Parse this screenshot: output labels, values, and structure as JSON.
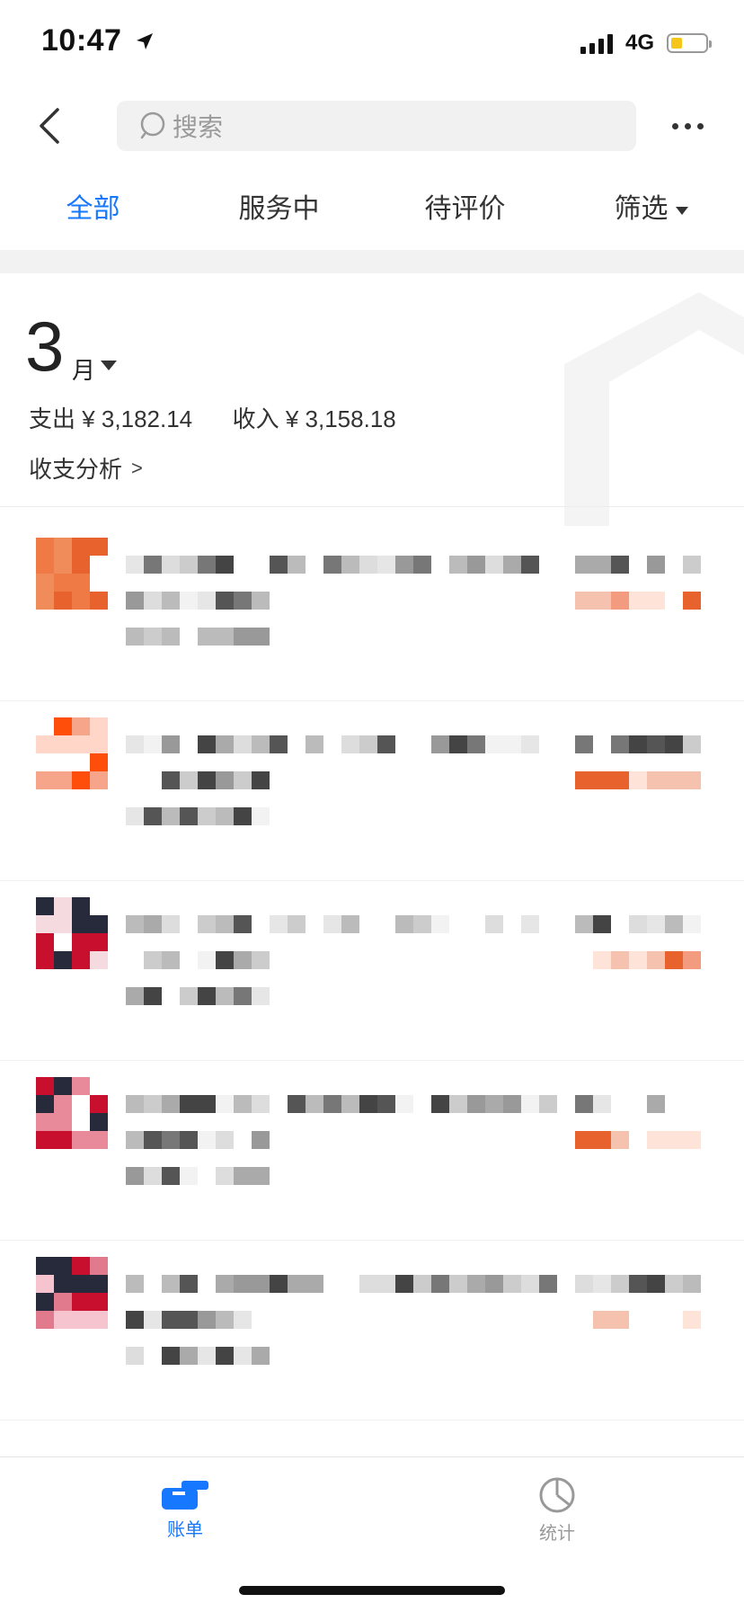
{
  "status_bar": {
    "time": "10:47",
    "network": "4G",
    "icons": [
      "location-arrow-icon",
      "signal-icon",
      "battery-icon"
    ]
  },
  "header": {
    "search_placeholder": "搜索",
    "icons": [
      "back-chevron-icon",
      "search-icon",
      "more-icon"
    ]
  },
  "tabs": [
    {
      "label": "全部",
      "active": true
    },
    {
      "label": "服务中",
      "active": false
    },
    {
      "label": "待评价",
      "active": false
    },
    {
      "label": "筛选",
      "active": false,
      "has_dropdown": true
    }
  ],
  "month": {
    "number": "3",
    "unit": "月",
    "expense_label": "支出",
    "expense_value": "¥ 3,182.14",
    "income_label": "收入",
    "income_value": "¥ 3,158.18",
    "analysis_label": "收支分析"
  },
  "bottom_tabs": [
    {
      "label": "账单",
      "icon": "bill-icon",
      "active": true
    },
    {
      "label": "统计",
      "icon": "pie-chart-icon",
      "active": false
    }
  ],
  "colors": {
    "accent": "#1677ff",
    "text_primary": "#222222",
    "text_secondary": "#999999",
    "search_bg": "#f1f1f1",
    "separator": "#f2f2f2"
  }
}
